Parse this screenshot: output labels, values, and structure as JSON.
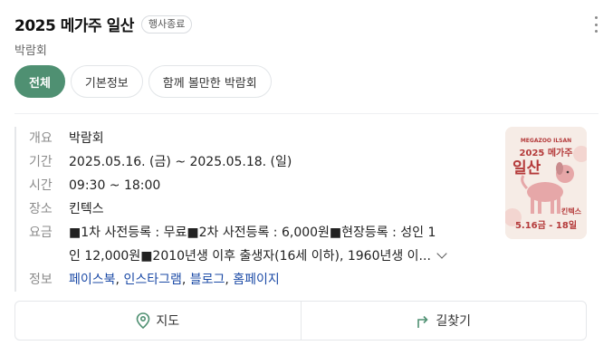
{
  "header": {
    "title": "2025 메가주 일산",
    "status_badge": "행사종료",
    "subtitle": "박람회",
    "more_icon": "more-vertical-icon"
  },
  "tabs": [
    {
      "label": "전체",
      "active": true
    },
    {
      "label": "기본정보",
      "active": false
    },
    {
      "label": "함께 볼만한 박람회",
      "active": false
    }
  ],
  "info": {
    "overview": {
      "label": "개요",
      "value": "박람회"
    },
    "period": {
      "label": "기간",
      "value": "2025.05.16. (금) ~  2025.05.18. (일)"
    },
    "time": {
      "label": "시간",
      "value": "09:30 ~ 18:00"
    },
    "place": {
      "label": "장소",
      "value": "킨텍스"
    },
    "fee": {
      "label": "요금",
      "line1": "■1차 사전등록 : 무료■2차 사전등록 : 6,000원■현장등록 : 성인 1",
      "line2": "인 12,000원■2010년생 이후 출생자(16세 이하), 1960년생 이..."
    },
    "links": {
      "label": "정보",
      "items": [
        "페이스북",
        "인스타그램",
        "블로그",
        "홈페이지"
      ],
      "separator": ","
    }
  },
  "poster": {
    "small_text": "MEGAZOO ILSAN",
    "mid_text": "2025 메가주",
    "big_text": "일산",
    "venue": "킨텍스",
    "date": "5.16금 - 18일"
  },
  "actions": {
    "map_label": "지도",
    "directions_label": "길찾기"
  },
  "colors": {
    "accent": "#4f9072",
    "link": "#1b4aa6"
  }
}
